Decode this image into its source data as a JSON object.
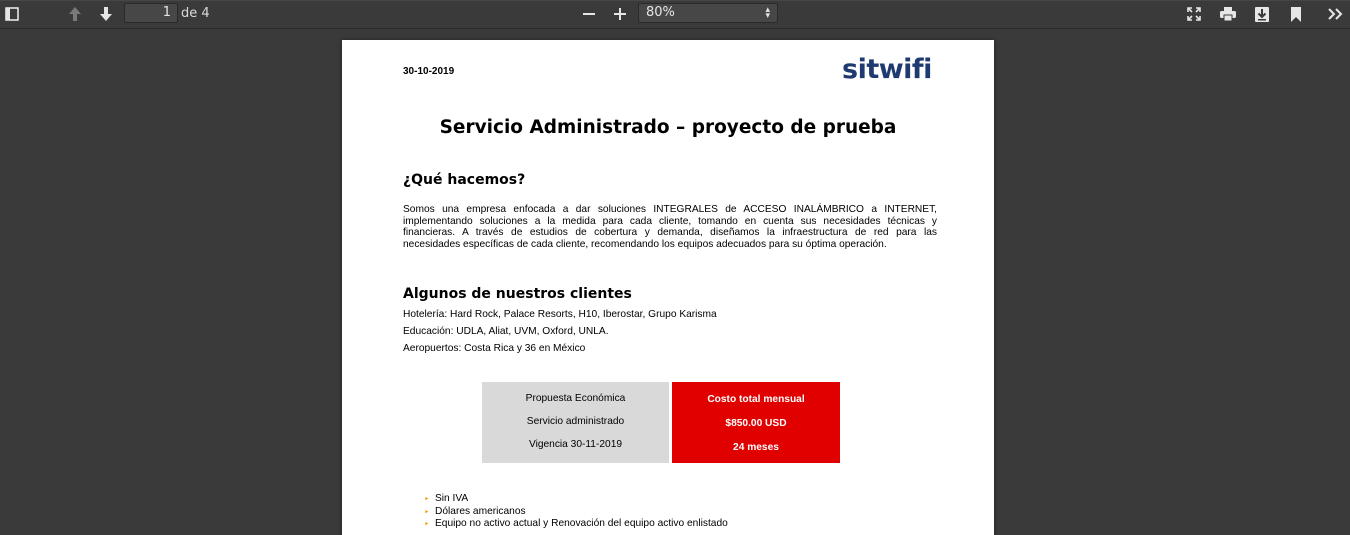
{
  "toolbar": {
    "page_number": "1",
    "page_of": "de 4",
    "zoom": "80%",
    "icons": [
      "sidebar-toggle-icon",
      "previous-page-icon",
      "next-page-icon",
      "zoom-out-icon",
      "zoom-in-icon",
      "presentation-mode-icon",
      "print-icon",
      "download-icon",
      "bookmark-icon",
      "tools-icon"
    ]
  },
  "document": {
    "date": "30-10-2019",
    "logo_text": "sitwifi",
    "title": "Servicio Administrado – proyecto de prueba",
    "section1": {
      "heading": "¿Qué hacemos?",
      "lines": [
        "Somos una empresa enfocada a dar soluciones INTEGRALES de ACCESO INALÁMBRICO a INTERNET,",
        "implementando soluciones a la medida para cada cliente, tomando en cuenta sus necesidades técnicas y",
        "financieras. A través de estudios de cobertura y demanda, diseñamos la infraestructura de red para las",
        "necesidades específicas de cada cliente, recomendando los equipos adecuados para su óptima operación."
      ]
    },
    "section2": {
      "heading": "Algunos de nuestros clientes",
      "lines": [
        "Hotelería: Hard Rock, Palace Resorts, H10, Iberostar, Grupo Karisma",
        "Educación: UDLA, Aliat, UVM, Oxford, UNLA.",
        "Aeropuertos: Costa Rica y 36 en México"
      ]
    },
    "proposal": {
      "left": [
        "Propuesta Económica",
        "Servicio administrado",
        "Vigencia 30-11-2019"
      ],
      "right": [
        "Costo total mensual",
        "$850.00 USD",
        "24 meses"
      ]
    },
    "bullets": [
      "Sin IVA",
      "Dólares americanos",
      "Equipo no activo actual y Renovación del equipo activo enlistado"
    ]
  },
  "colors": {
    "viewer_background": "#3a3a3a",
    "logo": "#1f3a70",
    "cost_box": "#e00000",
    "proposal_box": "#d9d9d9",
    "bullet_marker": "#f0a000"
  }
}
